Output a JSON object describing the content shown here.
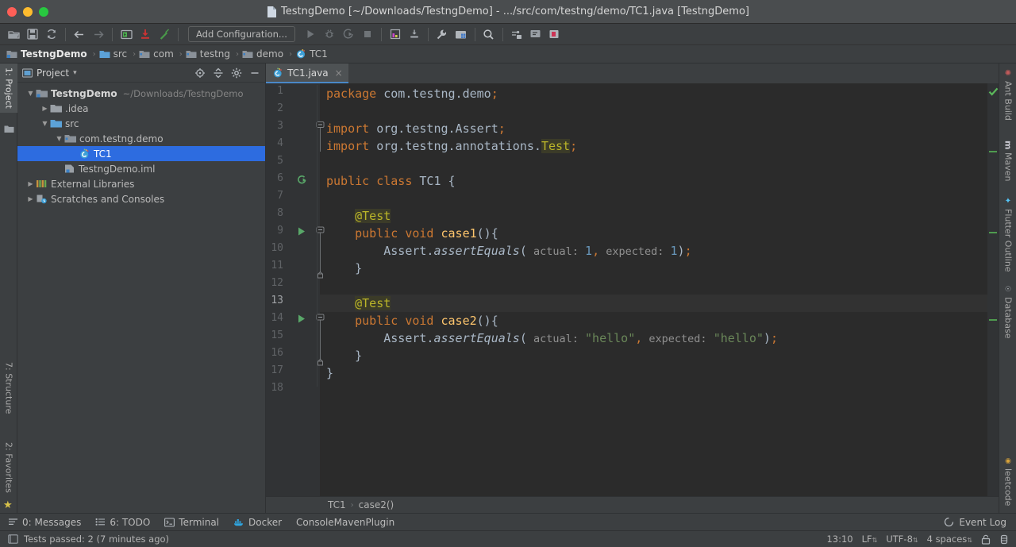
{
  "window": {
    "title": "TestngDemo [~/Downloads/TestngDemo] - .../src/com/testng/demo/TC1.java [TestngDemo]",
    "traffic_lights": [
      "close",
      "minimize",
      "zoom"
    ]
  },
  "toolbar": {
    "items": [
      {
        "name": "open-folder-icon",
        "label": "Open"
      },
      {
        "name": "save-all-icon",
        "label": "Save All"
      },
      {
        "name": "sync-icon",
        "label": "Synchronize"
      },
      {
        "name": "back-arrow-icon",
        "label": "Back"
      },
      {
        "name": "forward-arrow-icon",
        "label": "Forward"
      },
      {
        "name": "console-icon",
        "label": "Console"
      },
      {
        "name": "update-project-icon",
        "label": "Update Project"
      },
      {
        "name": "build-hammer-icon",
        "label": "Build Project"
      }
    ],
    "run_config_label": "Add Configuration...",
    "run_items": [
      {
        "name": "run-icon",
        "label": "Run"
      },
      {
        "name": "debug-icon",
        "label": "Debug"
      },
      {
        "name": "run-coverage-icon",
        "label": "Run with Coverage"
      },
      {
        "name": "stop-icon",
        "label": "Stop"
      }
    ],
    "right_items": [
      {
        "name": "profiler-icon",
        "label": "Profiler"
      },
      {
        "name": "attach-icon",
        "label": "Attach"
      },
      {
        "name": "settings-wrench-icon",
        "label": "Settings"
      },
      {
        "name": "project-structure-icon",
        "label": "Project Structure"
      },
      {
        "name": "search-icon",
        "label": "Search Everywhere"
      },
      {
        "name": "vcs-update-icon",
        "label": "VCS Update"
      },
      {
        "name": "commit-icon",
        "label": "Commit"
      },
      {
        "name": "plugin-icon",
        "label": "Plugin"
      }
    ]
  },
  "breadcrumb": {
    "items": [
      {
        "label": "TestngDemo",
        "icon": "module-icon",
        "selected": true
      },
      {
        "label": "src",
        "icon": "source-folder-icon",
        "selected": false
      },
      {
        "label": "com",
        "icon": "package-icon",
        "selected": false
      },
      {
        "label": "testng",
        "icon": "package-icon",
        "selected": false
      },
      {
        "label": "demo",
        "icon": "package-icon",
        "selected": false
      },
      {
        "label": "TC1",
        "icon": "java-class-icon",
        "selected": false
      }
    ],
    "separator": "›"
  },
  "left_rail": {
    "tabs": [
      {
        "label": "1: Project",
        "active": true,
        "icon": "project-icon"
      },
      {
        "label": "7: Structure",
        "active": false,
        "icon": "structure-icon"
      },
      {
        "label": "2: Favorites",
        "active": false,
        "icon": "star-icon"
      }
    ]
  },
  "right_rail": {
    "tabs": [
      {
        "label": "Ant Build",
        "icon": "ant-icon"
      },
      {
        "label": "Maven",
        "icon": "maven-icon"
      },
      {
        "label": "Flutter Outline",
        "icon": "flutter-icon"
      },
      {
        "label": "Database",
        "icon": "database-icon"
      },
      {
        "label": "leetcode",
        "icon": "leetcode-icon"
      }
    ]
  },
  "project_panel": {
    "title": "Project",
    "dropdown_caret": "▾",
    "header_icons": [
      {
        "name": "locate-target-icon",
        "label": "Select Opened File"
      },
      {
        "name": "collapse-all-icon",
        "label": "Collapse All"
      },
      {
        "name": "gear-icon",
        "label": "Settings"
      },
      {
        "name": "hide-icon",
        "label": "Hide"
      }
    ],
    "tree": [
      {
        "depth": 0,
        "label": "TestngDemo",
        "path": "~/Downloads/TestngDemo",
        "arrow": "down",
        "icon": "module-icon",
        "selected": false,
        "bold": true
      },
      {
        "depth": 1,
        "label": ".idea",
        "path": "",
        "arrow": "right",
        "icon": "folder-icon",
        "selected": false,
        "bold": false
      },
      {
        "depth": 1,
        "label": "src",
        "path": "",
        "arrow": "down",
        "icon": "source-folder-icon",
        "selected": false,
        "bold": false
      },
      {
        "depth": 2,
        "label": "com.testng.demo",
        "path": "",
        "arrow": "down",
        "icon": "package-icon",
        "selected": false,
        "bold": false
      },
      {
        "depth": 3,
        "label": "TC1",
        "path": "",
        "arrow": "none",
        "icon": "java-class-icon",
        "selected": true,
        "bold": false
      },
      {
        "depth": 2,
        "label": "TestngDemo.iml",
        "path": "",
        "arrow": "none",
        "icon": "iml-icon",
        "selected": false,
        "bold": false
      },
      {
        "depth": 0,
        "label": "External Libraries",
        "path": "",
        "arrow": "right",
        "icon": "libraries-icon",
        "selected": false,
        "bold": false
      },
      {
        "depth": 0,
        "label": "Scratches and Consoles",
        "path": "",
        "arrow": "right",
        "icon": "scratches-icon",
        "selected": false,
        "bold": false
      }
    ]
  },
  "editor": {
    "tab": {
      "label": "TC1.java",
      "icon": "java-class-icon",
      "close": "×"
    },
    "breadcrumb": {
      "class": "TC1",
      "member": "case2()",
      "sep": "›"
    },
    "inspection_status": "ok",
    "lines": [
      {
        "n": 1,
        "text": "package com.testng.demo;"
      },
      {
        "n": 2,
        "text": ""
      },
      {
        "n": 3,
        "text": "import org.testng.Assert;"
      },
      {
        "n": 4,
        "text": "import org.testng.annotations.Test;"
      },
      {
        "n": 5,
        "text": ""
      },
      {
        "n": 6,
        "text": "public class TC1 {"
      },
      {
        "n": 7,
        "text": ""
      },
      {
        "n": 8,
        "text": "    @Test"
      },
      {
        "n": 9,
        "text": "    public void case1(){"
      },
      {
        "n": 10,
        "text": "        Assert.assertEquals( actual: 1, expected: 1);"
      },
      {
        "n": 11,
        "text": "    }"
      },
      {
        "n": 12,
        "text": ""
      },
      {
        "n": 13,
        "text": "    @Test"
      },
      {
        "n": 14,
        "text": "    public void case2(){"
      },
      {
        "n": 15,
        "text": "        Assert.assertEquals( actual: \"hello\", expected: \"hello\");"
      },
      {
        "n": 16,
        "text": "    }"
      },
      {
        "n": 17,
        "text": "}"
      },
      {
        "n": 18,
        "text": ""
      }
    ],
    "current_line": 13,
    "gutter_markers": [
      {
        "line": 6,
        "type": "run-all-tests-icon"
      },
      {
        "line": 9,
        "type": "run-test-icon"
      },
      {
        "line": 14,
        "type": "run-test-icon"
      }
    ],
    "colors": {
      "background": "#2b2b2b",
      "gutter": "#313335",
      "keyword": "#cc7832",
      "string": "#6a8759",
      "number": "#6897bb",
      "method": "#ffc66d",
      "annotation": "#bbb529",
      "text": "#a9b7c6",
      "param_hint": "#909090",
      "selection": "#2d6ce0"
    }
  },
  "bottom_bar": {
    "items": [
      {
        "label": "0: Messages",
        "mnemonic": "0",
        "icon": "messages-icon"
      },
      {
        "label": "6: TODO",
        "mnemonic": "6",
        "icon": "todo-icon"
      },
      {
        "label": "Terminal",
        "mnemonic": "",
        "icon": "terminal-icon"
      },
      {
        "label": "Docker",
        "mnemonic": "",
        "icon": "docker-icon"
      },
      {
        "label": "ConsoleMavenPlugin",
        "mnemonic": "",
        "icon": ""
      }
    ],
    "event_log": {
      "label": "Event Log",
      "icon": "event-log-icon"
    }
  },
  "status_bar": {
    "message": "Tests passed: 2 (7 minutes ago)",
    "message_icon": "tests-passed-icon",
    "caret_position": "13:10",
    "line_separator": "LF",
    "encoding": "UTF-8",
    "indent": "4 spaces",
    "lock_icon": "lock-icon",
    "inspector_icon": "inspector-icon",
    "spinner": "⇅"
  }
}
